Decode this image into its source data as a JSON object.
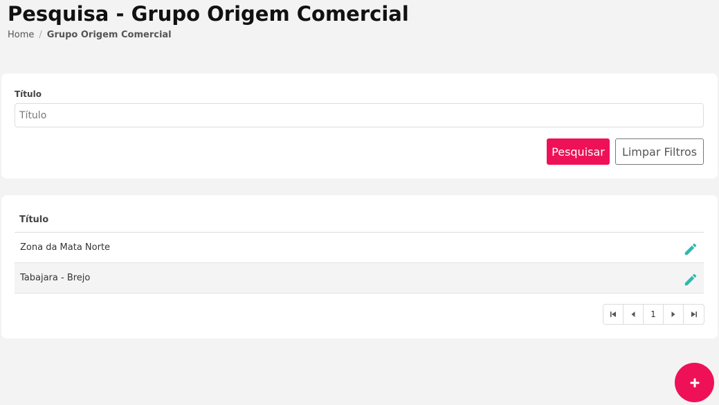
{
  "header": {
    "title": "Pesquisa - Grupo Origem Comercial",
    "breadcrumb": {
      "home": "Home",
      "separator": "/",
      "current": "Grupo Origem Comercial"
    }
  },
  "filter": {
    "field_label": "Título",
    "input_value": "",
    "input_placeholder": "Título",
    "search_label": "Pesquisar",
    "clear_label": "Limpar Filtros"
  },
  "table": {
    "column_title": "Título",
    "rows": [
      {
        "title": "Zona da Mata Norte",
        "action_icon": "pencil-icon"
      },
      {
        "title": "Tabajara - Brejo",
        "action_icon": "pencil-icon"
      }
    ]
  },
  "pagination": {
    "current_page": "1"
  },
  "fab": {
    "icon": "plus-icon"
  },
  "colors": {
    "accent": "#ee1158",
    "edit_icon": "#2fb8b0",
    "background": "#f3f3f3"
  }
}
